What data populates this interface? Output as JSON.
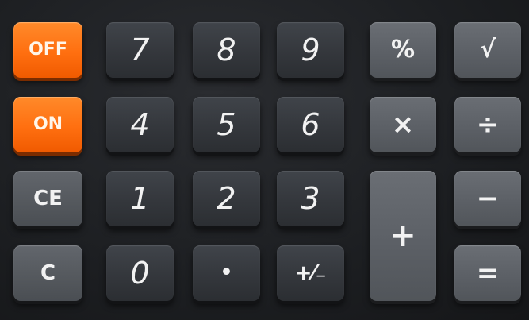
{
  "keys": {
    "off": "OFF",
    "on": "ON",
    "ce": "CE",
    "c": "C",
    "seven": "7",
    "eight": "8",
    "nine": "9",
    "four": "4",
    "five": "5",
    "six": "6",
    "one": "1",
    "two": "2",
    "three": "3",
    "zero": "0",
    "decimal": "•",
    "sign": "+⁄₋",
    "percent": "%",
    "sqrt": "√",
    "multiply": "×",
    "divide": "÷",
    "plus": "+",
    "minus": "−",
    "equals": "="
  },
  "colors": {
    "power_keys": "#ff6f10",
    "digit_keys": "#35383d",
    "operator_keys": "#5c6066",
    "body": "#1d1f22"
  }
}
